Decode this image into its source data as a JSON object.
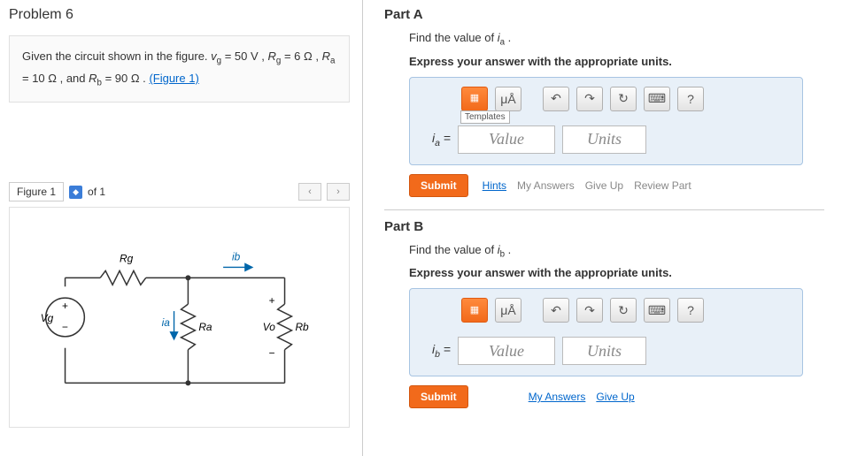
{
  "problem": {
    "title": "Problem 6",
    "given_html": "Given the circuit shown in the figure. <i>v</i><sub>g</sub> = 50 V , <i>R</i><sub>g</sub> = 6 Ω , <i>R</i><sub>a</sub> = 10 Ω , and <i>R</i><sub>b</sub> = 90 Ω .",
    "figure_link": "(Figure 1)"
  },
  "figure_nav": {
    "label": "Figure 1",
    "of_text": "of 1",
    "prev": "‹",
    "next": "›"
  },
  "circuit": {
    "vg": "Vg",
    "rg": "Rg",
    "ra": "Ra",
    "rb": "Rb",
    "ia": "ia",
    "ib": "ib",
    "vo": "Vo",
    "plus": "+",
    "minus": "−"
  },
  "partA": {
    "heading": "Part A",
    "prompt_html": "Find the value of <i>i</i><sub>a</sub> .",
    "instruction": "Express your answer with the appropriate units.",
    "lhs_html": "<i>i</i><sub>a</sub> =",
    "value_placeholder": "Value",
    "units_placeholder": "Units",
    "toolbar": {
      "templates": "Templates",
      "ua": "μÅ",
      "undo": "↶",
      "redo": "↷",
      "reset": "↻",
      "keyboard": "⌨",
      "help": "?"
    },
    "submit": "Submit",
    "links": {
      "hints": "Hints",
      "my_answers": "My Answers",
      "give_up": "Give Up",
      "review": "Review Part"
    }
  },
  "partB": {
    "heading": "Part B",
    "prompt_html": "Find the value of <i>i</i><sub>b</sub> .",
    "instruction": "Express your answer with the appropriate units.",
    "lhs_html": "<i>i</i><sub>b</sub> =",
    "value_placeholder": "Value",
    "units_placeholder": "Units",
    "toolbar": {
      "ua": "μÅ",
      "undo": "↶",
      "redo": "↷",
      "reset": "↻",
      "keyboard": "⌨",
      "help": "?"
    },
    "submit": "Submit",
    "links": {
      "my_answers": "My Answers",
      "give_up": "Give Up"
    }
  }
}
